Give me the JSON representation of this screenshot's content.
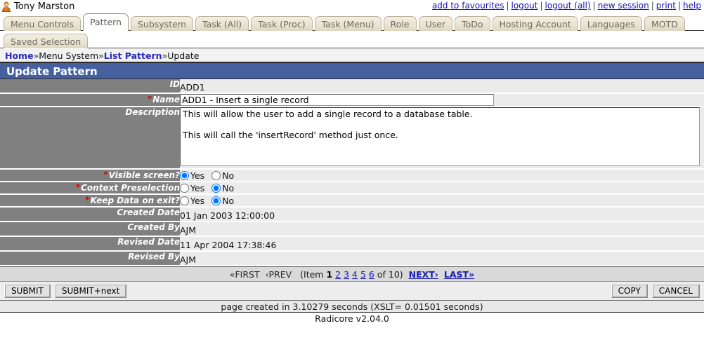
{
  "header": {
    "user_name": "Tony Marston",
    "user_icon": "user-avatar-icon",
    "links": [
      {
        "label": "add to favourites"
      },
      {
        "label": "logout"
      },
      {
        "label": "logout (all)"
      },
      {
        "label": "new session"
      },
      {
        "label": "print"
      },
      {
        "label": "help"
      }
    ],
    "link_separator": "|"
  },
  "tabs_row1": [
    {
      "label": "Menu Controls",
      "active": false
    },
    {
      "label": "Pattern",
      "active": true
    },
    {
      "label": "Subsystem",
      "active": false
    },
    {
      "label": "Task (All)",
      "active": false
    },
    {
      "label": "Task (Proc)",
      "active": false
    },
    {
      "label": "Task (Menu)",
      "active": false
    },
    {
      "label": "Role",
      "active": false
    },
    {
      "label": "User",
      "active": false
    },
    {
      "label": "ToDo",
      "active": false
    },
    {
      "label": "Hosting Account",
      "active": false
    },
    {
      "label": "Languages",
      "active": false
    },
    {
      "label": "MOTD",
      "active": false
    }
  ],
  "tabs_row2": [
    {
      "label": "Saved Selection",
      "active": false
    }
  ],
  "breadcrumb": {
    "items": [
      {
        "label": "Home",
        "link": true
      },
      {
        "label": "Menu System",
        "link": false
      },
      {
        "label": "List Pattern",
        "link": true
      },
      {
        "label": "Update",
        "link": false
      }
    ],
    "separator": "»"
  },
  "page_title": "Update Pattern",
  "form": {
    "id": {
      "label": "ID",
      "value": "ADD1",
      "required": false
    },
    "name": {
      "label": "Name",
      "value": "ADD1 - Insert a single record",
      "required": true
    },
    "description": {
      "label": "Description",
      "value": "This will allow the user to add a single record to a database table.\n\nThis will call the 'insertRecord' method just once.",
      "required": false
    },
    "visible_screen": {
      "label": "Visible screen?",
      "required": true,
      "selected": "Yes",
      "options": [
        "Yes",
        "No"
      ]
    },
    "context_preselection": {
      "label": "Context Preselection",
      "required": true,
      "selected": "No",
      "options": [
        "Yes",
        "No"
      ]
    },
    "keep_data_on_exit": {
      "label": "Keep Data on exit?",
      "required": true,
      "selected": "No",
      "options": [
        "Yes",
        "No"
      ]
    },
    "created_date": {
      "label": "Created Date",
      "value": "01 Jan 2003 12:00:00"
    },
    "created_by": {
      "label": "Created By",
      "value": "AJM"
    },
    "revised_date": {
      "label": "Revised Date",
      "value": "11 Apr 2004 17:38:46"
    },
    "revised_by": {
      "label": "Revised By",
      "value": "AJM"
    }
  },
  "pagination": {
    "first": "«FIRST",
    "prev": "‹PREV",
    "item_prefix": "(Item",
    "current": "1",
    "pages": [
      "2",
      "3",
      "4",
      "5",
      "6"
    ],
    "of_text": "of 10)",
    "next": "NEXT›",
    "last": "LAST»"
  },
  "buttons": {
    "submit": "SUBMIT",
    "submit_next": "SUBMIT+next",
    "copy": "COPY",
    "cancel": "CANCEL"
  },
  "footer": {
    "timing": "page created in 3.10279 seconds (XSLT= 0.01501 seconds)",
    "version": "Radicore v2.04.0"
  },
  "colors": {
    "title_bar": "#46609e",
    "label_cell": "#808080",
    "value_cell": "#ebebeb",
    "link": "#1414b4",
    "required_asterisk": "#e00000",
    "tab_inactive": "#eae4d2"
  }
}
